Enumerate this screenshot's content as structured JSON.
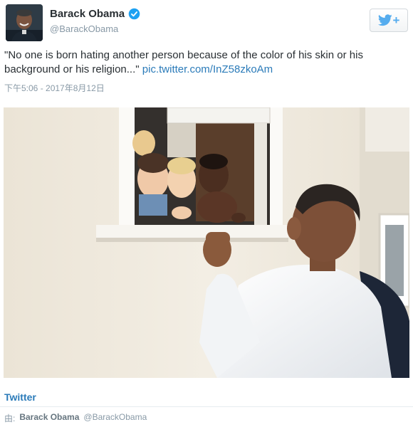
{
  "author": {
    "display_name": "Barack Obama",
    "handle": "@BarackObama",
    "verified": true,
    "avatar_icon": "user-avatar"
  },
  "follow_button": {
    "icon": "twitter-bird-icon",
    "plus": "+",
    "color": "#55acee"
  },
  "tweet": {
    "text": "\"No one is born hating another person because of the color of his skin or his background or his religion...\"",
    "link_text": "pic.twitter.com/InZ58zkoAm",
    "timestamp": "下午5:06 - 2017年8月12日"
  },
  "media": {
    "icon": "photo-image"
  },
  "footer": {
    "source_label": "Twitter",
    "by_prefix": "由:",
    "by_name": "Barack Obama",
    "by_handle": "@BarackObama"
  },
  "colors": {
    "link": "#2b7bb9",
    "muted": "#8899a6",
    "text": "#292f33"
  }
}
